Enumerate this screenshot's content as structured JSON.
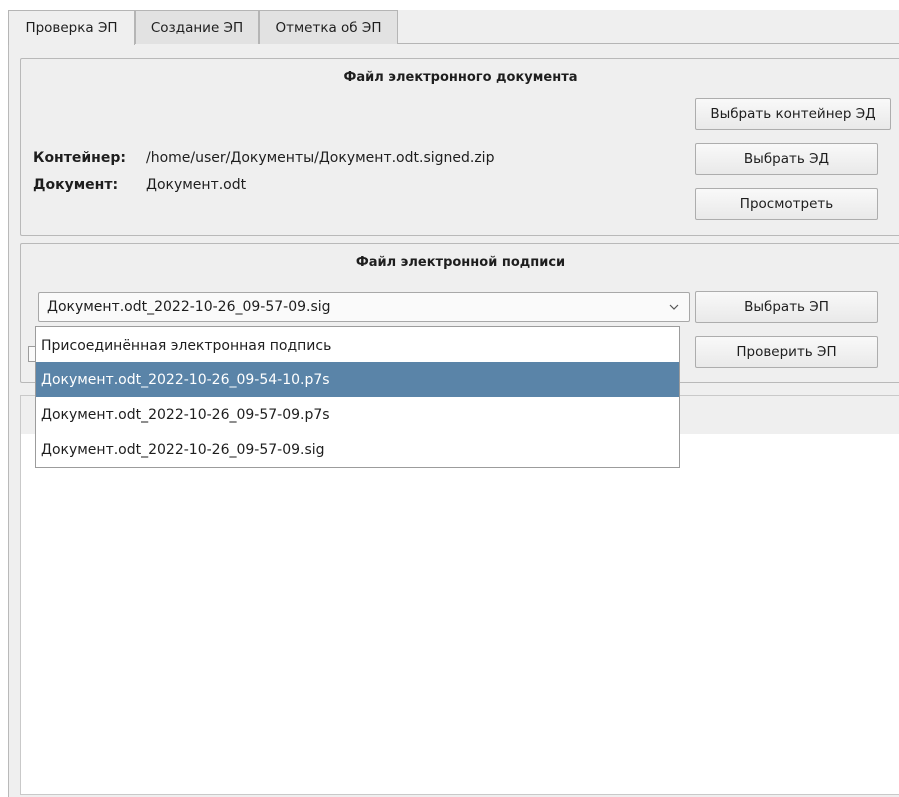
{
  "tabs": [
    {
      "label": "Проверка ЭП",
      "active": true
    },
    {
      "label": "Создание ЭП",
      "active": false
    },
    {
      "label": "Отметка об ЭП",
      "active": false
    }
  ],
  "doc_group": {
    "title": "Файл электронного документа",
    "container_label": "Контейнер:",
    "container_value": "/home/user/Документы/Документ.odt.signed.zip",
    "document_label": "Документ:",
    "document_value": "Документ.odt",
    "buttons": {
      "choose_container": "Выбрать контейнер ЭД",
      "choose_doc": "Выбрать ЭД",
      "view": "Просмотреть"
    }
  },
  "sig_group": {
    "title": "Файл электронной подписи",
    "selected": "Документ.odt_2022-10-26_09-57-09.sig",
    "buttons": {
      "choose_sig": "Выбрать ЭП",
      "verify_sig": "Проверить ЭП"
    },
    "options": [
      "Присоединённая электронная подпись",
      "Документ.odt_2022-10-26_09-54-10.p7s",
      "Документ.odt_2022-10-26_09-57-09.p7s",
      "Документ.odt_2022-10-26_09-57-09.sig"
    ],
    "highlighted_index": 1
  },
  "colors": {
    "highlight": "#5a84a8",
    "window_bg": "#efefef"
  }
}
